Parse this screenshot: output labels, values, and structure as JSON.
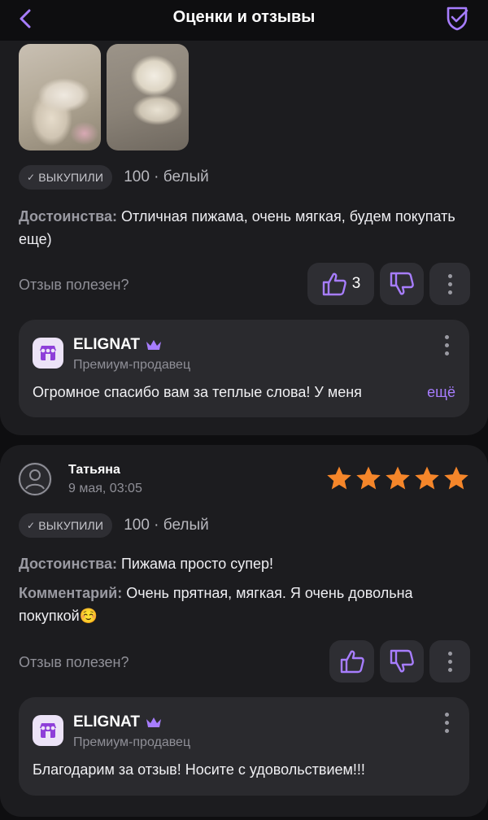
{
  "header": {
    "title": "Оценки и отзывы",
    "accent": "#a77dff"
  },
  "review1": {
    "badge": "ВЫКУПИЛИ",
    "variant": "100 · белый",
    "pros_label": "Достоинства:",
    "pros_text": " Отличная пижама, очень мягкая, будем покупать еще)",
    "helpful_label": "Отзыв полезен?",
    "likes": "3",
    "reply": {
      "seller": "ELIGNAT",
      "seller_type": "Премиум-продавец",
      "text": "Огромное спасибо вам за теплые слова! У меня",
      "more": "ещё"
    }
  },
  "review2": {
    "author": "Татьяна",
    "date": "9 мая, 03:05",
    "rating": 5,
    "badge": "ВЫКУПИЛИ",
    "variant": "100 · белый",
    "pros_label": "Достоинства:",
    "pros_text": " Пижама просто супер!",
    "comment_label": "Комментарий:",
    "comment_text": " Очень прятная, мягкая. Я очень довольна покупкой☺️",
    "helpful_label": "Отзыв полезен?",
    "reply": {
      "seller": "ELIGNAT",
      "seller_type": "Премиум-продавец",
      "text": "Благодарим за отзыв! Носите с удовольствием!!!"
    }
  },
  "colors": {
    "star": "#f5862a",
    "card": "#1c1c1f",
    "reply_bg": "#2a2a2e"
  }
}
